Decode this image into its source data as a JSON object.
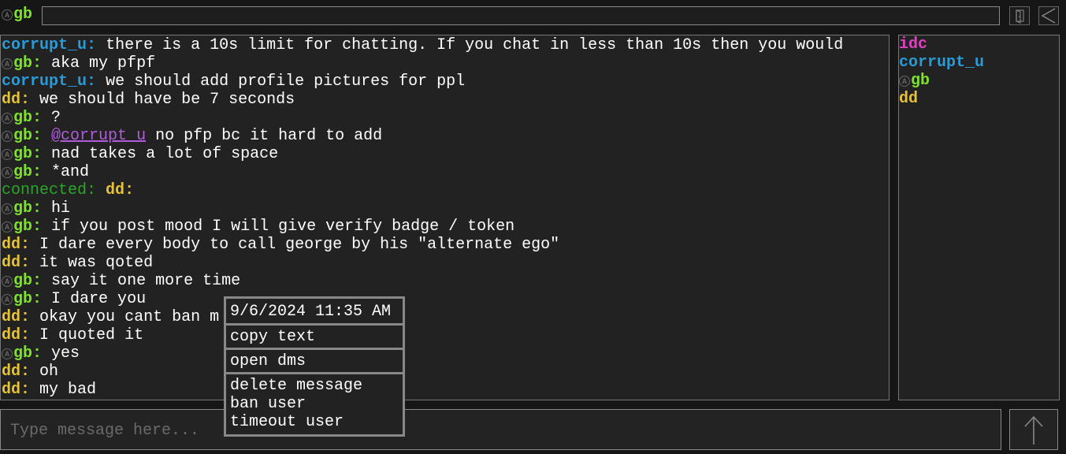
{
  "header": {
    "current_user": "gb",
    "mod_badge": "A",
    "search_value": "",
    "icons": [
      "exit-icon",
      "back-chevron-icon"
    ]
  },
  "chat": {
    "messages": [
      {
        "user": "corrupt_u",
        "text": "there is a 10s limit for chatting. If you chat in less than 10s then you would"
      },
      {
        "user": "gb",
        "text": "aka my pfpf"
      },
      {
        "user": "corrupt_u",
        "text": "we should add profile pictures for ppl"
      },
      {
        "user": "dd",
        "text": "we should have be 7 seconds"
      },
      {
        "user": "gb",
        "text": "?"
      },
      {
        "user": "gb",
        "mention": "@corrupt_u",
        "text": "no pfp bc it hard to add"
      },
      {
        "user": "gb",
        "text": "nad takes a lot of space"
      },
      {
        "user": "gb",
        "text": "*and"
      },
      {
        "system": "connected:",
        "user": "dd"
      },
      {
        "user": "gb",
        "text": "hi"
      },
      {
        "user": "gb",
        "text": "if you post mood I will give verify badge / token"
      },
      {
        "user": "dd",
        "text": "I dare every body to call george by his \"alternate ego\""
      },
      {
        "user": "dd",
        "text": "it was qoted"
      },
      {
        "user": "gb",
        "text": "say it one more time"
      },
      {
        "user": "gb",
        "text": "I dare you"
      },
      {
        "user": "dd",
        "text": "okay you cant ban m"
      },
      {
        "user": "dd",
        "text": "I quoted it"
      },
      {
        "user": "gb",
        "text": "yes"
      },
      {
        "user": "dd",
        "text": "oh"
      },
      {
        "user": "dd",
        "text": "my bad"
      }
    ]
  },
  "users": [
    {
      "name": "idc",
      "color": "#e23fc4"
    },
    {
      "name": "corrupt_u",
      "color": "#2a9bd6"
    },
    {
      "name": "gb",
      "color": "#7ee02f",
      "mod": true
    },
    {
      "name": "dd",
      "color": "#e6c236"
    }
  ],
  "composer": {
    "placeholder": "Type message here...",
    "value": "",
    "send_icon": "up-arrow-icon"
  },
  "context_menu": {
    "timestamp": "9/6/2024 11:35 AM",
    "copy_text": "copy text",
    "open_dms": "open dms",
    "delete_message": "delete message",
    "ban_user": "ban user",
    "timeout_user": "timeout user"
  },
  "colors": {
    "corrupt_u": "#2a9bd6",
    "gb": "#7ee02f",
    "dd": "#e6c236",
    "idc": "#e23fc4",
    "system": "#2aa52a",
    "mention": "#b15bdd"
  }
}
